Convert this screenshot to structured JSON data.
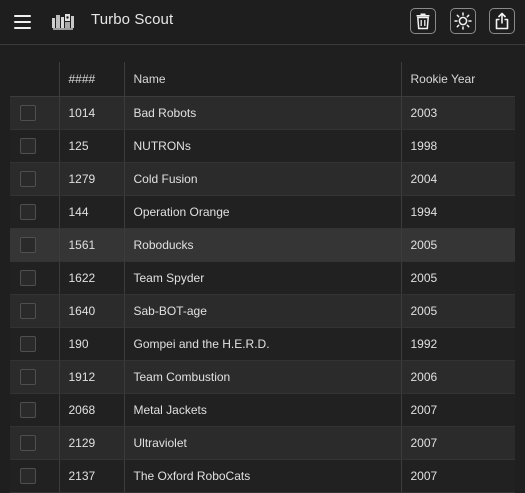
{
  "app": {
    "title": "Turbo Scout"
  },
  "toolbar": {
    "icons": [
      "menu-icon",
      "robot-logo-icon",
      "trash-icon",
      "sun-icon",
      "share-icon"
    ]
  },
  "table": {
    "columns": [
      "",
      "####",
      "Name",
      "Rookie Year"
    ],
    "rows": [
      {
        "number": "1014",
        "name": "Bad Robots",
        "year": "2003"
      },
      {
        "number": "125",
        "name": "NUTRONs",
        "year": "1998"
      },
      {
        "number": "1279",
        "name": "Cold Fusion",
        "year": "2004"
      },
      {
        "number": "144",
        "name": "Operation Orange",
        "year": "1994"
      },
      {
        "number": "1561",
        "name": "Roboducks",
        "year": "2005"
      },
      {
        "number": "1622",
        "name": "Team Spyder",
        "year": "2005"
      },
      {
        "number": "1640",
        "name": "Sab-BOT-age",
        "year": "2005"
      },
      {
        "number": "190",
        "name": "Gompei and the H.E.R.D.",
        "year": "1992"
      },
      {
        "number": "1912",
        "name": "Team Combustion",
        "year": "2006"
      },
      {
        "number": "2068",
        "name": "Metal Jackets",
        "year": "2007"
      },
      {
        "number": "2129",
        "name": "Ultraviolet",
        "year": "2007"
      },
      {
        "number": "2137",
        "name": "The Oxford RoboCats",
        "year": "2007"
      }
    ]
  }
}
